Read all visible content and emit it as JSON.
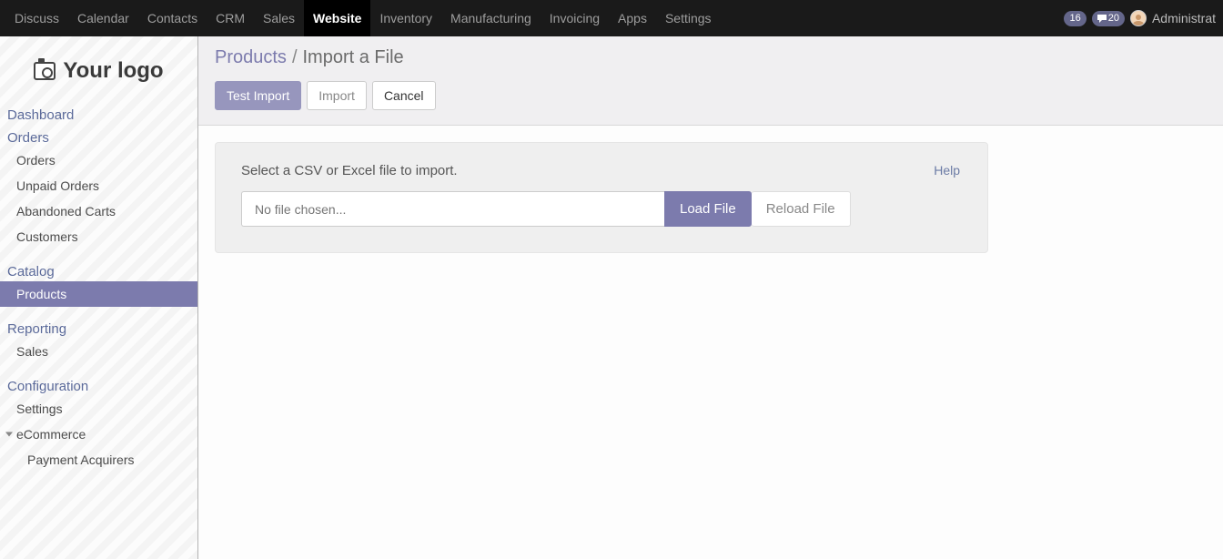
{
  "navbar": {
    "items": [
      {
        "label": "Discuss"
      },
      {
        "label": "Calendar"
      },
      {
        "label": "Contacts"
      },
      {
        "label": "CRM"
      },
      {
        "label": "Sales"
      },
      {
        "label": "Website"
      },
      {
        "label": "Inventory"
      },
      {
        "label": "Manufacturing"
      },
      {
        "label": "Invoicing"
      },
      {
        "label": "Apps"
      },
      {
        "label": "Settings"
      }
    ],
    "active": "Website",
    "badge_chat": "16",
    "badge_msgs": "20",
    "user": "Administrat"
  },
  "logo_text": "Your logo",
  "sidebar": {
    "dashboard": "Dashboard",
    "orders_header": "Orders",
    "orders": "Orders",
    "unpaid": "Unpaid Orders",
    "abandoned": "Abandoned Carts",
    "customers": "Customers",
    "catalog": "Catalog",
    "products": "Products",
    "reporting": "Reporting",
    "sales": "Sales",
    "configuration": "Configuration",
    "settings": "Settings",
    "ecommerce": "eCommerce",
    "payment": "Payment Acquirers"
  },
  "breadcrumb": {
    "parent": "Products",
    "current": "Import a File"
  },
  "buttons": {
    "test_import": "Test Import",
    "import": "Import",
    "cancel": "Cancel"
  },
  "import_panel": {
    "instruction": "Select a CSV or Excel file to import.",
    "help": "Help",
    "placeholder": "No file chosen...",
    "load": "Load File",
    "reload": "Reload File"
  }
}
